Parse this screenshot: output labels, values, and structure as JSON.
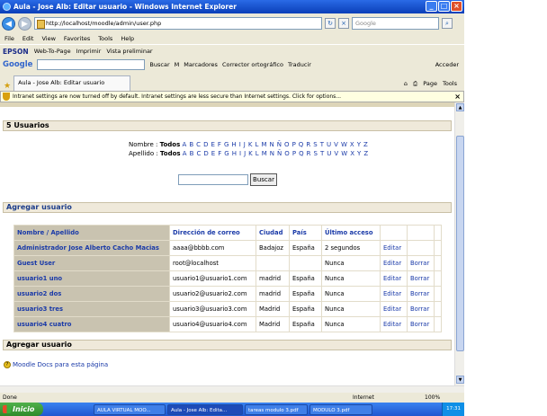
{
  "window": {
    "title": "Aula - Jose Alb: Editar usuario - Windows Internet Explorer"
  },
  "address": {
    "url": "http://localhost/moodle/admin/user.php",
    "search_placeholder": "Google"
  },
  "menu": [
    "File",
    "Edit",
    "View",
    "Favorites",
    "Tools",
    "Help"
  ],
  "toolbar1": {
    "brand": "EPSON",
    "web_to_page": "Web-To-Page",
    "print": "Imprimir",
    "preview": "Vista preliminar"
  },
  "toolbar2": {
    "google": "Google",
    "buscar": "Buscar",
    "marcadores": "Marcadores",
    "corrector": "Corrector ortográfico",
    "traducir": "Traducir",
    "acceder": "Acceder"
  },
  "tab": {
    "title": "Aula - Jose Alb: Editar usuario",
    "page": "Page",
    "tools": "Tools"
  },
  "infobar": {
    "text": "Intranet settings are now turned off by default. Intranet settings are less secure than Internet settings. Click for options..."
  },
  "page": {
    "users_heading": "5 Usuarios",
    "nombre_label": "Nombre :",
    "apellido_label": "Apellido :",
    "todos": "Todos",
    "letters": "A B C D E F G H I J K L M N Ñ O P Q R S T U V W X Y Z",
    "search_button": "Buscar",
    "add_user_heading": "Agregar usuario",
    "add_user_heading_bottom": "Agregar usuario",
    "moodle_docs": "Moodle Docs para esta página",
    "columns": {
      "name": "Nombre",
      "sep": "/",
      "surname": "Apellido",
      "email": "Dirección de correo",
      "city": "Ciudad",
      "country": "País",
      "last_access": "Último acceso"
    },
    "rows": [
      {
        "name": "Administrador Jose Alberto Cacho Macias",
        "email": "aaaa@bbbb.com",
        "city": "Badajoz",
        "country": "España",
        "last": "2 segundos",
        "edit": "Editar",
        "delete": ""
      },
      {
        "name": "Guest User",
        "email": "root@localhost",
        "city": "",
        "country": "",
        "last": "Nunca",
        "edit": "Editar",
        "delete": "Borrar"
      },
      {
        "name": "usuario1 uno",
        "email": "usuario1@usuario1.com",
        "city": "madrid",
        "country": "España",
        "last": "Nunca",
        "edit": "Editar",
        "delete": "Borrar"
      },
      {
        "name": "usuario2 dos",
        "email": "usuario2@usuario2.com",
        "city": "madrid",
        "country": "España",
        "last": "Nunca",
        "edit": "Editar",
        "delete": "Borrar"
      },
      {
        "name": "usuario3 tres",
        "email": "usuario3@usuario3.com",
        "city": "Madrid",
        "country": "España",
        "last": "Nunca",
        "edit": "Editar",
        "delete": "Borrar"
      },
      {
        "name": "usuario4 cuatro",
        "email": "usuario4@usuario4.com",
        "city": "Madrid",
        "country": "España",
        "last": "Nunca",
        "edit": "Editar",
        "delete": "Borrar"
      }
    ]
  },
  "status": {
    "text": "Done",
    "zone": "Internet",
    "zoom": "100%"
  },
  "taskbar": {
    "start": "Inicio",
    "tasks": [
      "AULA VIRTUAL MOO...",
      "Aula - Jose Alb: Edita...",
      "tareas modulo 3.pdf",
      "MODULO 3.pdf"
    ],
    "clock": "17:31"
  }
}
